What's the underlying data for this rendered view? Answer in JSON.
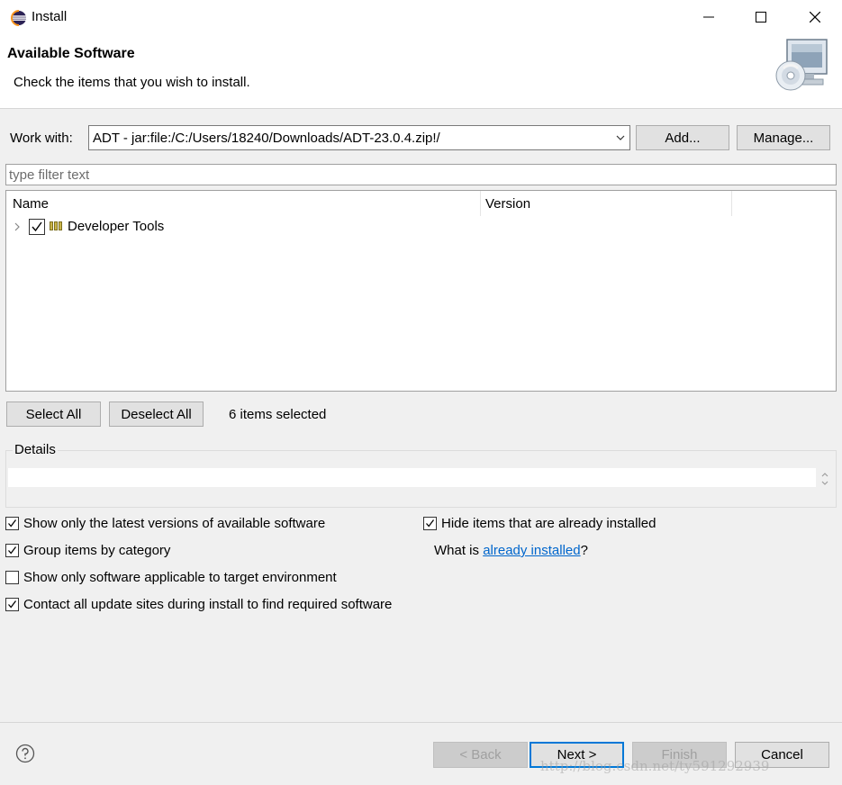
{
  "window": {
    "title": "Install",
    "controls": {
      "minimize": "minimize-icon",
      "maximize": "maximize-icon",
      "close": "close-icon"
    }
  },
  "header": {
    "title": "Available Software",
    "subtitle": "Check the items that you wish to install."
  },
  "work_with": {
    "label": "Work with:",
    "value": "ADT - jar:file:/C:/Users/18240/Downloads/ADT-23.0.4.zip!/",
    "add_label": "Add...",
    "manage_label": "Manage..."
  },
  "filter": {
    "placeholder": "type filter text"
  },
  "tree": {
    "columns": [
      "Name",
      "Version"
    ],
    "rows": [
      {
        "label": "Developer Tools",
        "version": "",
        "checked": true,
        "expanded": false
      }
    ]
  },
  "selection": {
    "select_all": "Select All",
    "deselect_all": "Deselect All",
    "count_text": "6 items selected"
  },
  "details": {
    "label": "Details"
  },
  "options": {
    "latest_versions": {
      "label": "Show only the latest versions of available software",
      "checked": true
    },
    "group_by_category": {
      "label": "Group items by category",
      "checked": true
    },
    "applicable_only": {
      "label": "Show only software applicable to target environment",
      "checked": false
    },
    "contact_all_sites": {
      "label": "Contact all update sites during install to find required software",
      "checked": true
    },
    "hide_installed": {
      "label": "Hide items that are already installed",
      "checked": true
    },
    "what_is_prefix": "What is ",
    "already_installed_link": "already installed",
    "what_is_suffix": "?"
  },
  "footer": {
    "back": "< Back",
    "next": "Next >",
    "finish": "Finish",
    "cancel": "Cancel"
  },
  "watermark": "http://blog.csdn.net/ty591292939",
  "colors": {
    "accent": "#0078d7",
    "link": "#0066cc",
    "dialog_bg": "#f0f0f0"
  }
}
